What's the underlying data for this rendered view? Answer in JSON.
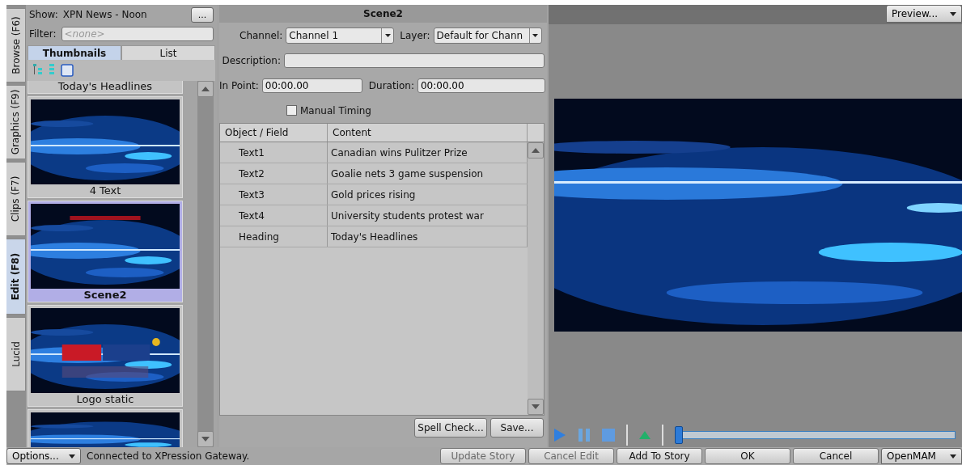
{
  "side_tabs": [
    {
      "label": "Browse (F6)",
      "selected": false
    },
    {
      "label": "Graphics (F9)",
      "selected": false
    },
    {
      "label": "Clips (F7)",
      "selected": false
    },
    {
      "label": "Edit (F8)",
      "selected": true
    },
    {
      "label": "Lucid",
      "selected": false
    }
  ],
  "browser": {
    "show_label": "Show:",
    "show_value": "XPN News - Noon",
    "more_button": "...",
    "filter_label": "Filter:",
    "filter_placeholder": "<none>",
    "view_tabs": [
      {
        "label": "Thumbnails",
        "selected": true
      },
      {
        "label": "List",
        "selected": false
      }
    ],
    "thumbnails": [
      {
        "kind": "caption_only",
        "caption": "Today's Headlines",
        "selected": false
      },
      {
        "kind": "text_lines",
        "caption": "4 Text",
        "selected": false
      },
      {
        "kind": "headlines",
        "caption": "Scene2",
        "selected": true
      },
      {
        "kind": "logo",
        "caption": "Logo static",
        "selected": false
      },
      {
        "kind": "partial",
        "selected": false
      }
    ]
  },
  "editor": {
    "title": "Scene2",
    "channel_label": "Channel:",
    "channel_value": "Channel 1",
    "layer_label": "Layer:",
    "layer_value": "Default for Chann",
    "description_label": "Description:",
    "in_point_label": "In Point:",
    "in_point_value": "00:00.00",
    "duration_label": "Duration:",
    "duration_value": "00:00.00",
    "manual_timing": {
      "label": "Manual Timing",
      "checked": false
    },
    "table": {
      "columns": [
        "Object / Field",
        "Content"
      ],
      "rows": [
        {
          "field": "Text1",
          "content": "Canadian wins Pulitzer Prize"
        },
        {
          "field": "Text2",
          "content": "Goalie nets 3 game suspension"
        },
        {
          "field": "Text3",
          "content": "Gold prices rising"
        },
        {
          "field": "Text4",
          "content": "University students protest war"
        },
        {
          "field": "Heading",
          "content": "Today's Headlines"
        }
      ]
    },
    "buttons": [
      "Spell Check...",
      "Save..."
    ]
  },
  "preview": {
    "menu_button": "Preview...",
    "scrub": {
      "level": 0
    }
  },
  "status_bar": {
    "options_button": "Options...",
    "message": "Connected to XPression Gateway.",
    "buttons": [
      {
        "label": "Update Story",
        "disabled": true
      },
      {
        "label": "Cancel Edit",
        "disabled": true
      },
      {
        "label": "Add To Story",
        "disabled": false
      },
      {
        "label": "OK",
        "disabled": false
      },
      {
        "label": "Cancel",
        "disabled": false
      }
    ],
    "openmam_button": "OpenMAM"
  }
}
